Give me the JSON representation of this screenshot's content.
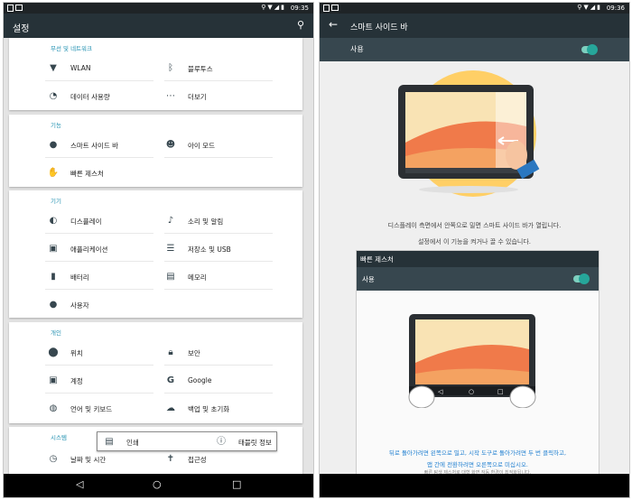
{
  "status": {
    "left_time": "09:35",
    "right_time": "09:36"
  },
  "left": {
    "title": "설정",
    "sections": [
      {
        "title": "무선 및 네트워크",
        "items": [
          {
            "label": "WLAN",
            "icon": "wifi-icon"
          },
          {
            "label": "블루투스",
            "icon": "bluetooth-icon"
          },
          {
            "label": "데이터 사용량",
            "icon": "data-usage-icon"
          },
          {
            "label": "더보기",
            "icon": "more-icon"
          }
        ]
      },
      {
        "title": "기능",
        "items": [
          {
            "label": "스마트 사이드 바",
            "icon": "smart-sidebar-icon"
          },
          {
            "label": "아이 모드",
            "icon": "kids-mode-icon"
          },
          {
            "label": "빠른 제스처",
            "icon": "gesture-icon"
          }
        ]
      },
      {
        "title": "기기",
        "items": [
          {
            "label": "디스플레이",
            "icon": "display-icon"
          },
          {
            "label": "소리 및 알림",
            "icon": "bell-icon"
          },
          {
            "label": "애플리케이션",
            "icon": "android-icon"
          },
          {
            "label": "저장소 및 USB",
            "icon": "storage-icon"
          },
          {
            "label": "배터리",
            "icon": "battery-icon"
          },
          {
            "label": "메모리",
            "icon": "memory-icon"
          },
          {
            "label": "사용자",
            "icon": "user-icon"
          }
        ]
      },
      {
        "title": "개인",
        "items": [
          {
            "label": "위치",
            "icon": "location-icon"
          },
          {
            "label": "보안",
            "icon": "lock-icon"
          },
          {
            "label": "계정",
            "icon": "account-icon"
          },
          {
            "label": "Google",
            "icon": "google-icon"
          },
          {
            "label": "언어 및 키보드",
            "icon": "globe-icon"
          },
          {
            "label": "백업 및 초기화",
            "icon": "backup-icon"
          }
        ]
      },
      {
        "title": "시스템",
        "items": [
          {
            "label": "날짜 및 시간",
            "icon": "clock-icon"
          },
          {
            "label": "접근성",
            "icon": "accessibility-icon"
          }
        ]
      }
    ],
    "overlay": {
      "print": "인쇄",
      "tablet_info": "태블릿 정보"
    }
  },
  "right": {
    "title": "스마트 사이드 바",
    "use_label": "사용",
    "description_line1": "디스플레이 측면에서 안쪽으로 밀면 스마트 사이드 바가 열립니다.",
    "description_line2": "설정에서 이 기능을 켜거나 끌 수 있습니다.",
    "gesture_title": "빠른 제스처",
    "gesture_use_label": "사용",
    "gesture_desc_line1": "뒤로 돌아가려면 왼쪽으로 밀고, 시작 도구로 돌아가려면 두 번 클릭하고,",
    "gesture_desc_line2": "앱 간에 전환하려면 오른쪽으로 미십시오.",
    "gesture_footnote": "빠른 탐색 제스처로 대형 화면 작동 환경이 최적화됩니다."
  },
  "colors": {
    "accent": "#26a69a",
    "toolbar": "#263238",
    "section_title": "#1f8fb0",
    "link_text": "#1f7fd0"
  }
}
